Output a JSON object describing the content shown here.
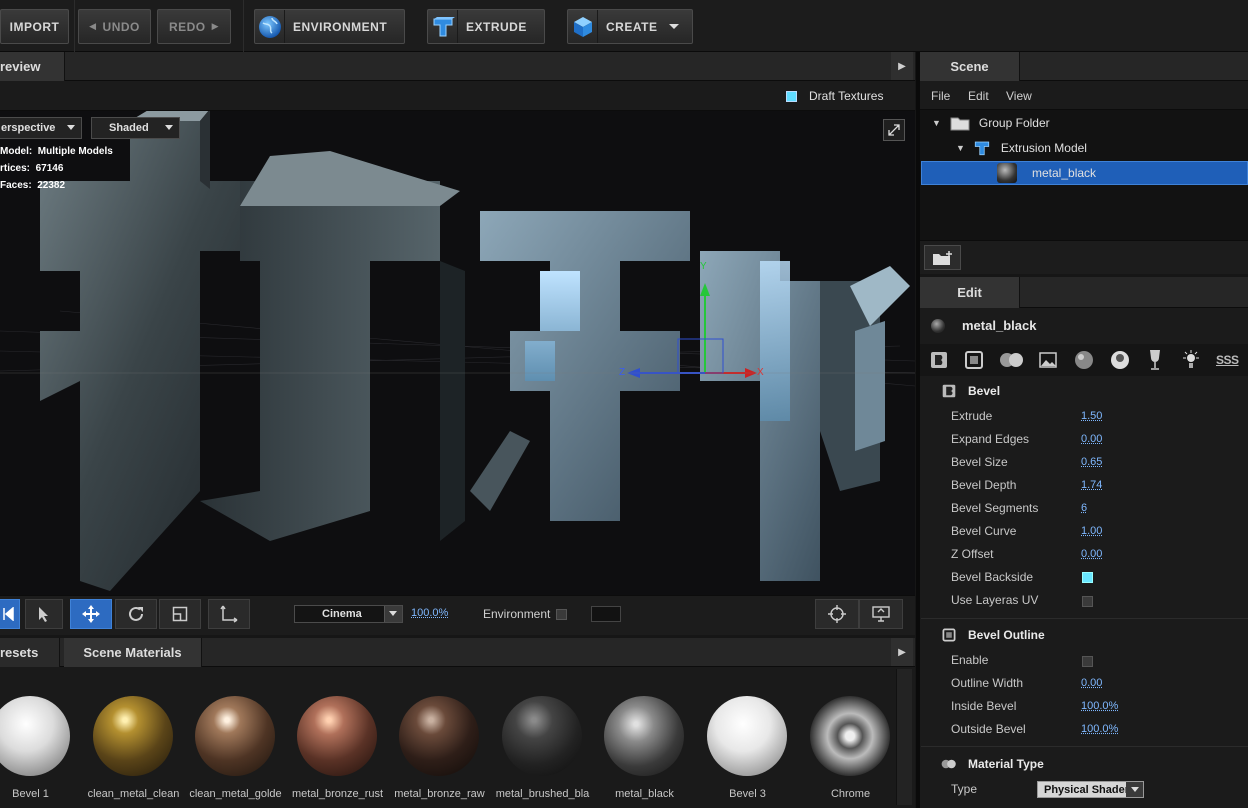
{
  "toolbar": {
    "import_label": "IMPORT",
    "undo_label": "UNDO",
    "redo_label": "REDO",
    "environment_label": "ENVIRONMENT",
    "extrude_label": "EXTRUDE",
    "create_label": "CREATE"
  },
  "preview": {
    "tab_label": "review",
    "draft_textures_label": "Draft Textures",
    "draft_textures_checked": true,
    "camera_dropdown": "erspective",
    "shading_dropdown": "Shaded",
    "info": {
      "model_label": "Model:",
      "model_value": "Multiple Models",
      "vertices_label": "rtices:",
      "vertices_value": "67146",
      "faces_label": "Faces:",
      "faces_value": "22382"
    },
    "gizmo": {
      "y": "Y",
      "z": "Z",
      "x": "X"
    },
    "bottom": {
      "render_mode": "Cinema",
      "zoom": "100.0%",
      "environment_label": "Environment"
    }
  },
  "scene": {
    "tab_label": "Scene",
    "menu": [
      "File",
      "Edit",
      "View"
    ],
    "tree": [
      {
        "label": "Group Folder"
      },
      {
        "label": "Extrusion Model"
      },
      {
        "label": "metal_black",
        "selected": true
      }
    ]
  },
  "edit": {
    "tab_label": "Edit",
    "material_name": "metal_black",
    "tab_icons": [
      "bevel-tab-icon",
      "bevel-outline-tab-icon",
      "material-tab-icon",
      "texture-tab-icon",
      "sphere-tab-icon",
      "reflection-tab-icon",
      "glass-tab-icon",
      "light-tab-icon",
      "sss-tab-icon"
    ],
    "sss_label": "SSS",
    "bevel": {
      "header": "Bevel",
      "extrude_label": "Extrude",
      "extrude_value": "1.50",
      "expand_edges_label": "Expand Edges",
      "expand_edges_value": "0.00",
      "bevel_size_label": "Bevel Size",
      "bevel_size_value": "0.65",
      "bevel_depth_label": "Bevel Depth",
      "bevel_depth_value": "1.74",
      "bevel_segments_label": "Bevel Segments",
      "bevel_segments_value": "6",
      "bevel_curve_label": "Bevel Curve",
      "bevel_curve_value": "1.00",
      "z_offset_label": "Z Offset",
      "z_offset_value": "0.00",
      "bevel_backside_label": "Bevel Backside",
      "bevel_backside_checked": true,
      "use_layeras_uv_label": "Use Layeras UV",
      "use_layeras_uv_checked": false
    },
    "bevel_outline": {
      "header": "Bevel Outline",
      "enable_label": "Enable",
      "enable_checked": false,
      "outline_width_label": "Outline Width",
      "outline_width_value": "0.00",
      "inside_bevel_label": "Inside Bevel",
      "inside_bevel_value": "100.0%",
      "outside_bevel_label": "Outside Bevel",
      "outside_bevel_value": "100.0%"
    },
    "material_type": {
      "header": "Material Type",
      "type_label": "Type",
      "type_value": "Physical Shader"
    }
  },
  "materials": {
    "presets_tab": "resets",
    "scene_materials_tab": "Scene Materials",
    "items": [
      {
        "label": "Bevel 1",
        "color": "#e8e8e8"
      },
      {
        "label": "clean_metal_clean",
        "color": "#8a6a2a"
      },
      {
        "label": "clean_metal_golde",
        "color": "#6b4a2a"
      },
      {
        "label": "metal_bronze_rust",
        "color": "#7a4630"
      },
      {
        "label": "metal_bronze_raw",
        "color": "#3d2a22"
      },
      {
        "label": "metal_brushed_bla",
        "color": "#2b2b2b"
      },
      {
        "label": "metal_black",
        "color": "#555555"
      },
      {
        "label": "Bevel 3",
        "color": "#f0f0f0"
      },
      {
        "label": "Chrome",
        "color": "#9a9a9a"
      }
    ]
  },
  "colors": {
    "accent": "#2d6bc1",
    "selection": "#1f5fb8",
    "checkbox_on": "#69e6ff",
    "link_value": "#7fb8ff"
  }
}
